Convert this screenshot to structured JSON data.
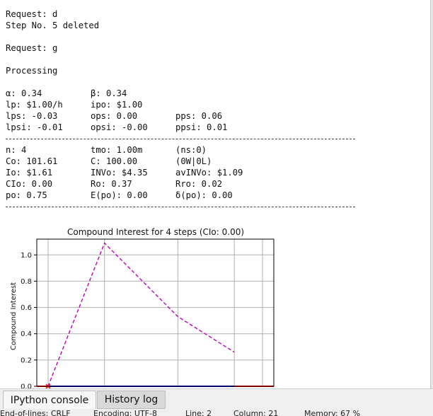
{
  "console": {
    "lines": {
      "l1": "Request: d",
      "l2": "Step No. 5 deleted",
      "l3": "Request: g",
      "l4": "Processing",
      "a": "α: 0.34",
      "beta": "β: 0.34",
      "lp": "lp: $1.00/h",
      "ipo": "ipo: $1.00",
      "lps": "lps: -0.03",
      "ops": "ops: 0.00",
      "pps": "pps: 0.06",
      "lpsi": "lpsi: -0.01",
      "opsi": "opsi: -0.00",
      "ppsi": "ppsi: 0.01",
      "n": "n: 4",
      "tmo": "tmo: 1.00m",
      "ns": "(ns:0)",
      "co": "Co: 101.61",
      "c": "C: 100.00",
      "owol": "(0W|0L)",
      "io": "Io: $1.61",
      "invo": "INVo: $4.35",
      "avinvo": "avINVo: $1.09",
      "cio": "CIo: 0.00",
      "ro": "Ro: 0.37",
      "rro": "Rro: 0.02",
      "po": "po: 0.75",
      "epo": "E(po): 0.00",
      "dpo": "δ(po): 0.00"
    }
  },
  "chart_data": {
    "type": "line",
    "title": "Compound Interest for 4 steps (CIo: 0.00)",
    "xlabel": "",
    "ylabel": "Compound Interest",
    "ylim": [
      0.0,
      1.12
    ],
    "xlim": [
      0.0,
      4.2
    ],
    "yticks": [
      "0.0",
      "0.2",
      "0.4",
      "0.6",
      "0.8",
      "1.0"
    ],
    "grid": true,
    "series": [
      {
        "values_x": [
          0.2,
          1.2,
          2.5,
          3.5
        ],
        "values_y": [
          0.0,
          1.09,
          0.53,
          0.26
        ],
        "style": "dashed",
        "color": "#c000c0"
      },
      {
        "values_x": [
          0.0,
          4.2
        ],
        "values_y": [
          0.0,
          0.0
        ],
        "style": "solid",
        "color": "#0000cc"
      },
      {
        "values_x": [
          0.0,
          0.2
        ],
        "values_y": [
          0.0,
          0.0
        ],
        "style": "solid",
        "color": "#ff0000"
      },
      {
        "values_x": [
          3.5,
          4.2
        ],
        "values_y": [
          0.0,
          0.0
        ],
        "style": "solid",
        "color": "#ff0000"
      }
    ],
    "markers": [
      {
        "x": 0.2,
        "y": 0.0,
        "color": "#ff0000"
      }
    ]
  },
  "tabs": {
    "ipython": "IPython console",
    "history": "History log"
  },
  "status": {
    "s1": "End-of-lines: CRLF",
    "s2": "Encoding: UTF-8",
    "s3": "Line: 2",
    "s4": "Column: 21",
    "s5": "Memory: 67 %"
  }
}
